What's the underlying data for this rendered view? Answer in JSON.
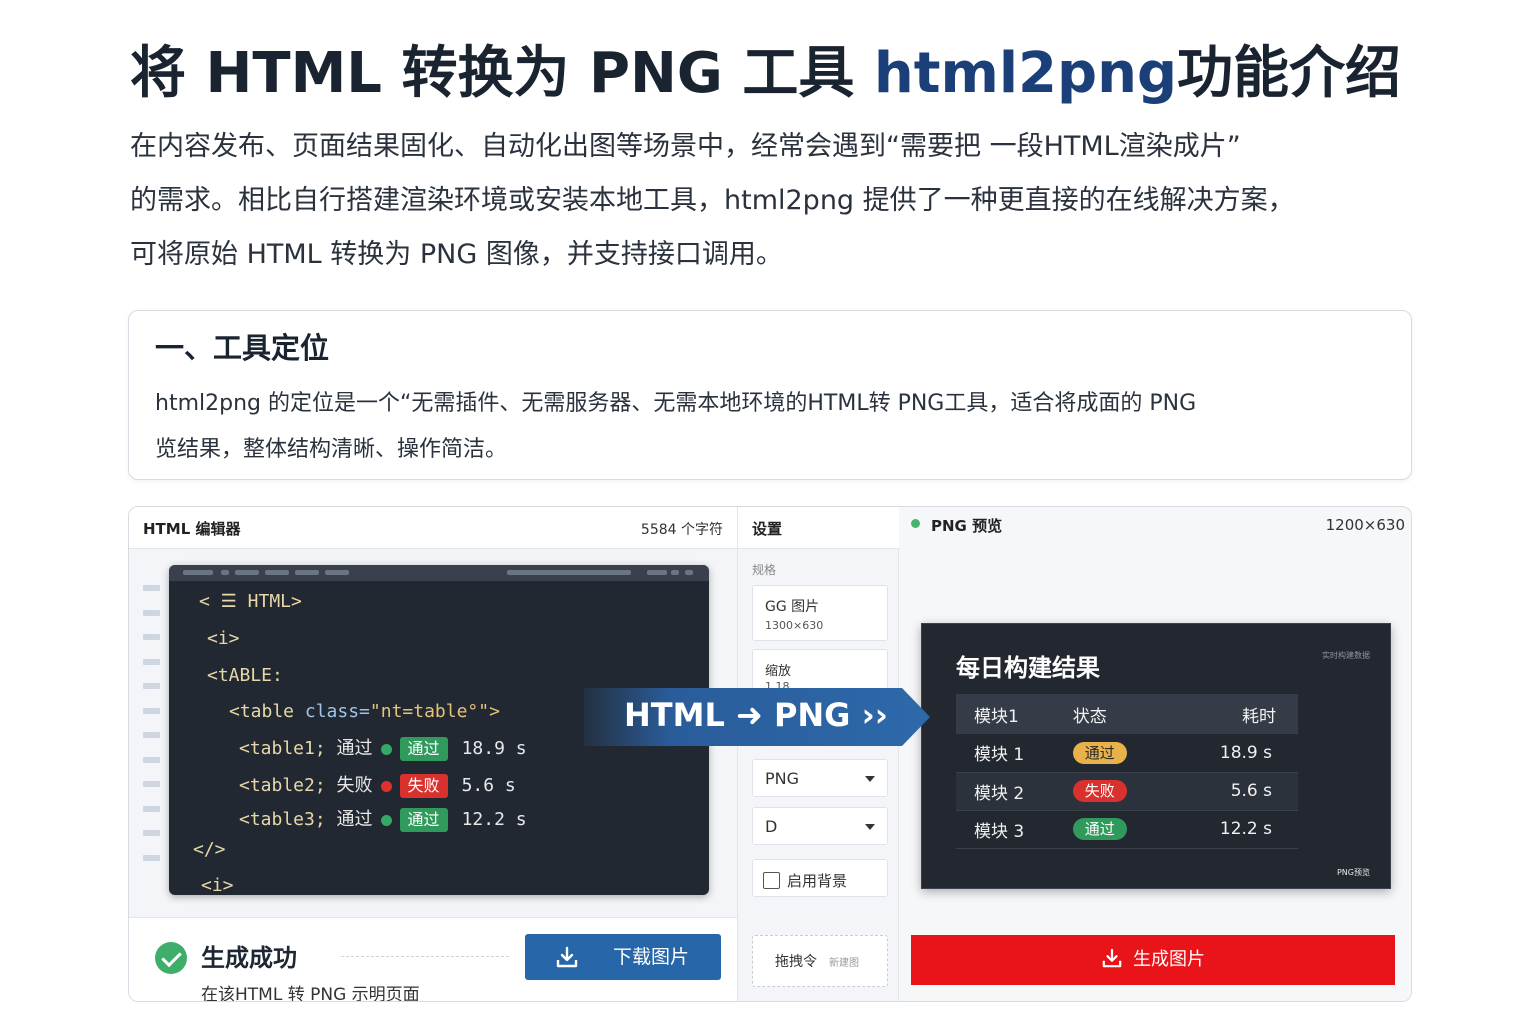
{
  "page": {
    "title_prefix": "将 HTML 转换为 PNG 工具 ",
    "title_accent": "html2png",
    "title_suffix": "功能介绍",
    "intro_lines": [
      "在内容发布、页面结果固化、自动化出图等场景中，经常会遇到“需要把 一段HTML渲染成片”",
      "的需求。相比自行搭建渲染环境或安装本地工具，html2png 提供了一种更直接的在线解决方案，",
      "可将原始 HTML 转换为 PNG 图像，并支持接口调用。"
    ]
  },
  "section1": {
    "heading": "一、工具定位",
    "lines": [
      "html2png 的定位是一个“无需插件、无需服务器、无需本地环境的HTML转 PNG工具，适合将成面的 PNG",
      "览结果，整体结构清晰、操作简洁。"
    ]
  },
  "editor": {
    "header_title": "HTML 编辑器",
    "char_count": "5584 个字符",
    "lines": {
      "l1": "< ☰ HTML>",
      "l2": "<i>",
      "l3": "<tABLE:",
      "l4_tag": "<table ",
      "l4_attr": "class=",
      "l4_val": "\"nt=table°\">",
      "l5_tag": "<table1; ",
      "l5_label": "通过",
      "l5_badge": "通过",
      "l5_time": "18.9 s",
      "l6_tag": "<table2; ",
      "l6_label": "失败",
      "l6_badge": "失败",
      "l6_time": "5.6 s",
      "l7_tag": "<table3; ",
      "l7_label": "通过",
      "l7_badge": "通过",
      "l7_time": "12.2 s",
      "l8": "</>",
      "l9": "<i>"
    }
  },
  "result": {
    "title": "生成成功",
    "subtitle": "在该HTML 转 PNG 示明页面",
    "download_label": "下载图片"
  },
  "settings": {
    "header_title": "设置",
    "size_label": "规格",
    "size_main": "GG 图片",
    "size_sub": "1300×630",
    "scale_label": "缩放",
    "scale_sub": "1.18",
    "format_value": "PNG",
    "quality_value": "D",
    "checkbox_label": "启用背景",
    "hint_main": "拖拽令",
    "hint_sub": "新建图"
  },
  "preview": {
    "header_title": "PNG 预览",
    "dimensions": "1200×630",
    "card_title": "每日构建结果",
    "tag": "实时构建数据",
    "columns": [
      "模块1",
      "状态",
      "耗时"
    ],
    "rows": [
      {
        "name": "模块 1",
        "status": "通过",
        "time": "18.9 s"
      },
      {
        "name": "模块 2",
        "status": "失败",
        "time": "5.6 s"
      },
      {
        "name": "模块 3",
        "status": "通过",
        "time": "12.2 s"
      }
    ],
    "brand": "PNG预览"
  },
  "banner": {
    "text": "HTML ➜ PNG  ››"
  },
  "generate_label": "生成图片",
  "colors": {
    "accent_blue": "#1b3f78",
    "success_green": "#2f9a5c",
    "fail_red": "#d9312e",
    "generate_red": "#e8141a",
    "download_blue": "#2766a8"
  }
}
